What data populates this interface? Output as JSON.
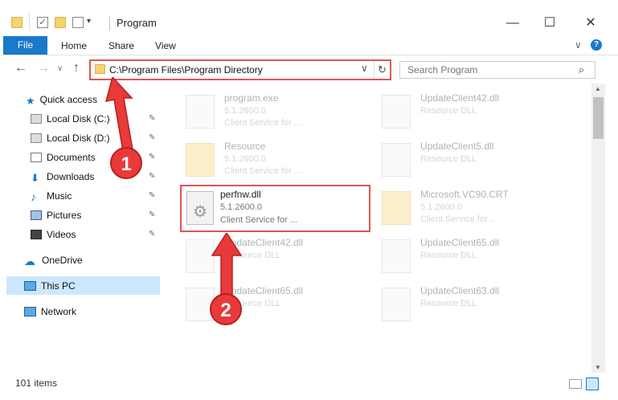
{
  "window": {
    "title": "Program",
    "controls": {
      "minimize": "—",
      "maximize": "☐",
      "close": "✕"
    }
  },
  "ribbon": {
    "tabs": [
      "File",
      "Home",
      "Share",
      "View"
    ],
    "expand": "∨",
    "help": "?"
  },
  "nav_buttons": {
    "back": "←",
    "forward": "→",
    "dropdown": "∨",
    "up": "↑"
  },
  "address": {
    "path": "C:\\Program Files\\Program Directory",
    "dropdown": "∨",
    "refresh": "↻"
  },
  "search": {
    "placeholder": "Search Program",
    "icon": "⌕"
  },
  "sidebar": {
    "quick_access": "Quick access",
    "items": [
      {
        "label": "Local Disk (C:)",
        "icon": "drive-icon",
        "pinned": true
      },
      {
        "label": "Local Disk (D:)",
        "icon": "drive-icon",
        "pinned": true
      },
      {
        "label": "Documents",
        "icon": "documents-icon",
        "pinned": true
      },
      {
        "label": "Downloads",
        "icon": "downloads-icon",
        "pinned": true
      },
      {
        "label": "Music",
        "icon": "music-icon",
        "pinned": true
      },
      {
        "label": "Pictures",
        "icon": "pictures-icon",
        "pinned": true
      },
      {
        "label": "Videos",
        "icon": "videos-icon",
        "pinned": true
      }
    ],
    "pin_glyph": "📌",
    "onedrive": "OneDrive",
    "this_pc": "This PC",
    "network": "Network"
  },
  "files": [
    {
      "name": "program.exe",
      "version": "5.1.2600.0",
      "desc": "Client Service for ...",
      "icon": "exe-icon",
      "dim": true
    },
    {
      "name": "UpdateClient42.dll",
      "version": "Resource DLL",
      "desc": "",
      "icon": "dll-icon",
      "dim": true
    },
    {
      "name": "Resource",
      "version": "5.1.2600.0",
      "desc": "Client Service for ...",
      "icon": "folder-icon",
      "dim": true
    },
    {
      "name": "UpdateClient5.dll",
      "version": "Resource DLL",
      "desc": "",
      "icon": "dll-icon",
      "dim": true
    },
    {
      "name": "perfnw.dll",
      "version": "5.1.2600.0",
      "desc": "Client Service for ...",
      "icon": "dll-gear-icon",
      "dim": false
    },
    {
      "name": "Microsoft.VC90.CRT",
      "version": "5.1.2600.0",
      "desc": "Client Service for ...",
      "icon": "folder-icon",
      "dim": true
    },
    {
      "name": "UpdateClient42.dll",
      "version": "Resource DLL",
      "desc": "",
      "icon": "dll-icon",
      "dim": true
    },
    {
      "name": "UpdateClient65.dll",
      "version": "Resource DLL",
      "desc": "",
      "icon": "dll-icon",
      "dim": true
    },
    {
      "name": "UpdateClient65.dll",
      "version": "Resource DLL",
      "desc": "",
      "icon": "dll-icon",
      "dim": true
    },
    {
      "name": "UpdateClient63.dll",
      "version": "Resource DLL",
      "desc": "",
      "icon": "dll-icon",
      "dim": true
    }
  ],
  "status": {
    "count": "101 items"
  },
  "callouts": [
    "1",
    "2"
  ],
  "colors": {
    "accent": "#1979ca",
    "highlight": "#e05555",
    "callout": "#e83a3a",
    "selected": "#cce8ff"
  }
}
